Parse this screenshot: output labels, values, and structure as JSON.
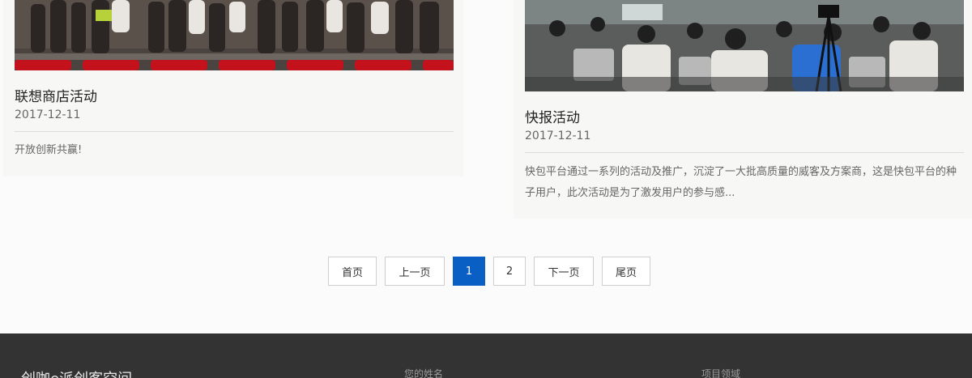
{
  "cards": [
    {
      "title": "联想商店活动",
      "date": "2017-12-11",
      "description": "开放创新共赢!"
    },
    {
      "title": "快报活动",
      "date": "2017-12-11",
      "description": "快包平台通过一系列的活动及推广，沉淀了一大批高质量的威客及方案商，这是快包平台的种子用户，此次活动是为了激发用户的参与感..."
    }
  ],
  "pagination": {
    "first": "首页",
    "prev": "上一页",
    "pages": [
      "1",
      "2"
    ],
    "current": "1",
    "next": "下一页",
    "last": "尾页"
  },
  "footer": {
    "brand": "创咖e派创客空间",
    "name_label": "您的姓名",
    "field_label": "项目领域"
  },
  "colors": {
    "accent": "#0a5fc4",
    "footer_bg": "#333333"
  }
}
